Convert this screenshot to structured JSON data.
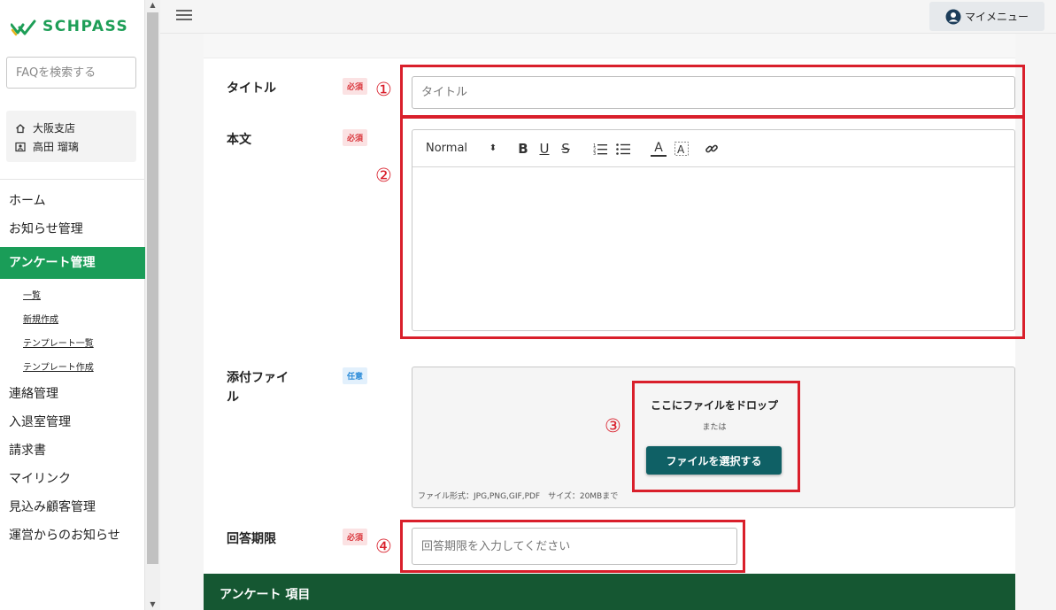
{
  "brand": {
    "name": "SCHPASS",
    "color": "#1e9e57"
  },
  "sidebar": {
    "search_placeholder": "FAQを検索する",
    "user": {
      "branch": "大阪支店",
      "name": "高田 瑠璃"
    },
    "nav": [
      {
        "label": "ホーム"
      },
      {
        "label": "お知らせ管理"
      },
      {
        "label": "アンケート管理",
        "active": true
      },
      {
        "label": "連絡管理"
      },
      {
        "label": "入退室管理"
      },
      {
        "label": "請求書"
      },
      {
        "label": "マイリンク"
      },
      {
        "label": "見込み顧客管理"
      },
      {
        "label": "運営からのお知らせ"
      }
    ],
    "sub_nav": [
      {
        "label": "一覧"
      },
      {
        "label": "新規作成"
      },
      {
        "label": "テンプレート一覧"
      },
      {
        "label": "テンプレート作成"
      }
    ]
  },
  "header": {
    "my_menu_label": "マイメニュー"
  },
  "form": {
    "title": {
      "label": "タイトル",
      "badge": "必須",
      "placeholder": "タイトル"
    },
    "body": {
      "label": "本文",
      "badge": "必須",
      "toolbar": {
        "format": "Normal",
        "icons": [
          "bold-icon",
          "underline-icon",
          "strikethrough-icon",
          "ordered-list-icon",
          "bullet-list-icon",
          "text-color-icon",
          "background-color-icon",
          "link-icon"
        ]
      }
    },
    "attachment": {
      "label_line1": "添付ファイ",
      "label_line2": "ル",
      "badge": "任意",
      "drop_title": "ここにファイルをドロップ",
      "or": "または",
      "select_button": "ファイルを選択する",
      "note": "ファイル形式：JPG,PNG,GIF,PDF　サイズ：20MBまで"
    },
    "deadline": {
      "label": "回答期限",
      "badge": "必須",
      "placeholder": "回答期限を入力してください"
    }
  },
  "section": {
    "title": "アンケート 項目"
  },
  "annotations": {
    "n1": "①",
    "n2": "②",
    "n3": "③",
    "n4": "④",
    "color": "#d91f2b"
  },
  "colors": {
    "active_nav": "#1a9d58",
    "primary_button": "#0f6065",
    "section_header": "#155732",
    "required_badge": "#d9343a",
    "optional_badge": "#2b8bd8"
  }
}
